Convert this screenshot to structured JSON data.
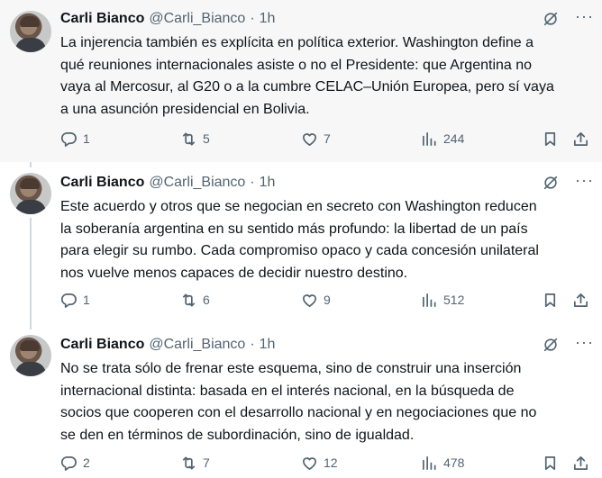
{
  "tweets": [
    {
      "name": "Carli Bianco",
      "handle": "@Carli_Bianco",
      "separator": "·",
      "time": "1h",
      "text": "La injerencia también es explícita en política exterior. Washington define a\nqué reuniones internacionales asiste o no el Presidente: que Argentina no\nvaya al Mercosur, al G20 o a la cumbre CELAC–Unión Europea, pero sí vaya\na una asunción presidencial en Bolivia.",
      "replies": "1",
      "reposts": "5",
      "likes": "7",
      "views": "244"
    },
    {
      "name": "Carli Bianco",
      "handle": "@Carli_Bianco",
      "separator": "·",
      "time": "1h",
      "text": "Este acuerdo y otros que se negocian en secreto con Washington reducen\nla soberanía argentina en su sentido más profundo: la libertad de un país\npara elegir su rumbo. Cada compromiso opaco y cada concesión unilateral\nnos vuelve menos capaces de decidir nuestro destino.",
      "replies": "1",
      "reposts": "6",
      "likes": "9",
      "views": "512"
    },
    {
      "name": "Carli Bianco",
      "handle": "@Carli_Bianco",
      "separator": "·",
      "time": "1h",
      "text": "No se trata sólo de frenar este esquema, sino de construir una inserción\ninternacional distinta: basada en el interés nacional, en la búsqueda de\nsocios que cooperen con el desarrollo nacional y en negociaciones que no\nse den en términos de subordinación, sino de igualdad.",
      "replies": "2",
      "reposts": "7",
      "likes": "12",
      "views": "478"
    }
  ],
  "icons": [
    "grok-icon",
    "more-icon",
    "reply-icon",
    "repost-icon",
    "like-icon",
    "views-icon",
    "bookmark-icon",
    "share-icon"
  ]
}
